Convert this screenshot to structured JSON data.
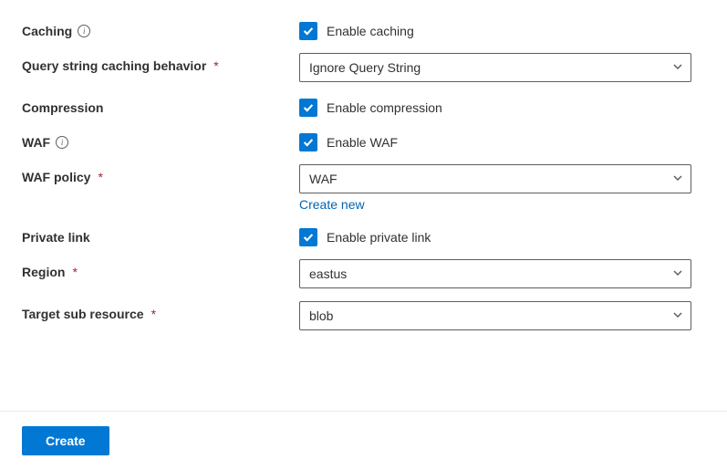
{
  "fields": {
    "caching": {
      "label": "Caching",
      "checkbox_label": "Enable caching"
    },
    "queryString": {
      "label": "Query string caching behavior",
      "value": "Ignore Query String"
    },
    "compression": {
      "label": "Compression",
      "checkbox_label": "Enable compression"
    },
    "waf": {
      "label": "WAF",
      "checkbox_label": "Enable WAF"
    },
    "wafPolicy": {
      "label": "WAF policy",
      "value": "WAF",
      "create_new": "Create new"
    },
    "privateLink": {
      "label": "Private link",
      "checkbox_label": "Enable private link"
    },
    "region": {
      "label": "Region",
      "value": "eastus"
    },
    "targetSubResource": {
      "label": "Target sub resource",
      "value": "blob"
    }
  },
  "footer": {
    "create": "Create"
  },
  "required_marker": "*"
}
